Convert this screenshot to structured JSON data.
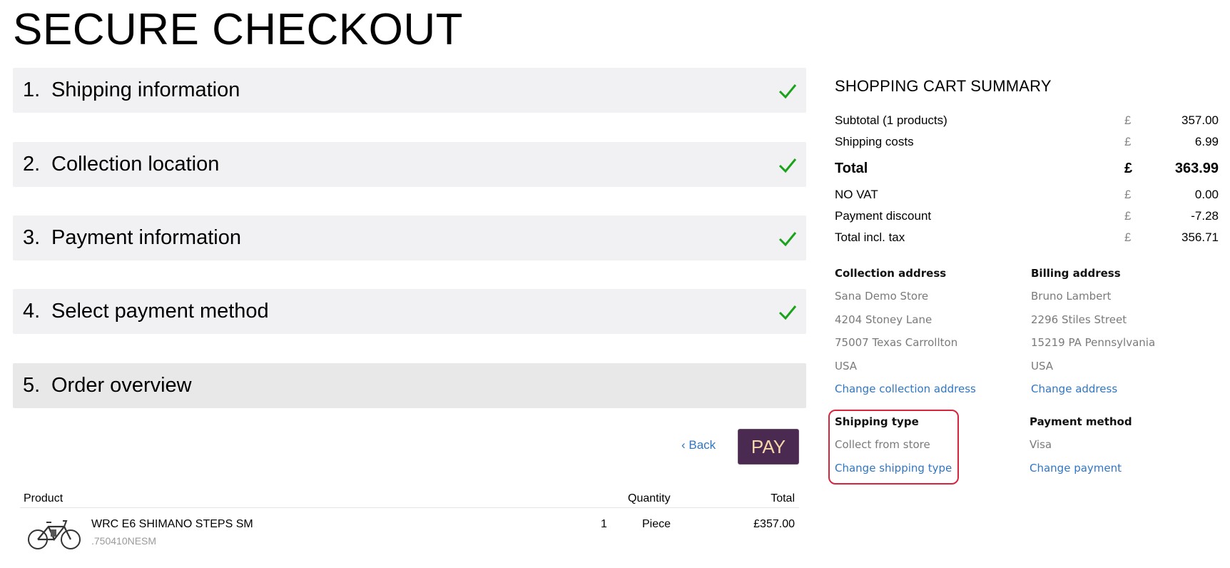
{
  "page": {
    "title": "SECURE CHECKOUT"
  },
  "steps": [
    {
      "number": "1.",
      "label": "Shipping information",
      "completed": true
    },
    {
      "number": "2.",
      "label": "Collection location",
      "completed": true
    },
    {
      "number": "3.",
      "label": "Payment information",
      "completed": true
    },
    {
      "number": "4.",
      "label": "Select payment method",
      "completed": true
    },
    {
      "number": "5.",
      "label": "Order overview",
      "completed": false
    }
  ],
  "actions": {
    "back_label": "‹ Back",
    "pay_label": "PAY"
  },
  "order_table": {
    "headers": {
      "product": "Product",
      "quantity": "Quantity",
      "total": "Total"
    },
    "rows": [
      {
        "name": "WRC E6 SHIMANO STEPS SM",
        "sku": ".750410NESM",
        "quantity": "1",
        "unit": "Piece",
        "total": "£357.00",
        "thumbnail_icon": "bicycle-icon"
      }
    ]
  },
  "summary": {
    "title": "SHOPPING CART SUMMARY",
    "rows": [
      {
        "label": "Subtotal (1 products)",
        "currency": "£",
        "value": "357.00"
      },
      {
        "label": "Shipping costs",
        "currency": "£",
        "value": "6.99"
      },
      {
        "label": "Total",
        "currency": "£",
        "value": "363.99"
      },
      {
        "label": "NO VAT",
        "currency": "£",
        "value": "0.00"
      },
      {
        "label": "Payment discount",
        "currency": "£",
        "value": "-7.28"
      },
      {
        "label": "Total incl. tax",
        "currency": "£",
        "value": "356.71"
      }
    ]
  },
  "collection_address": {
    "title": "Collection address",
    "lines": [
      "Sana Demo Store",
      "4204 Stoney Lane",
      "75007 Texas Carrollton",
      "USA"
    ],
    "link": "Change collection address"
  },
  "billing_address": {
    "title": "Billing address",
    "lines": [
      "Bruno Lambert",
      "2296 Stiles Street",
      "15219 PA Pennsylvania",
      "USA"
    ],
    "link": "Change address"
  },
  "shipping_type": {
    "title": "Shipping type",
    "value": "Collect from store",
    "link": "Change shipping type"
  },
  "payment_method": {
    "title": "Payment method",
    "value": "Visa",
    "link": "Change payment"
  },
  "colors": {
    "step_background": "#f1f1f3",
    "check_green": "#1aa31a",
    "pay_button": "#4a2a50",
    "link_blue": "#2f76c4",
    "highlight_red": "#d8253e"
  }
}
